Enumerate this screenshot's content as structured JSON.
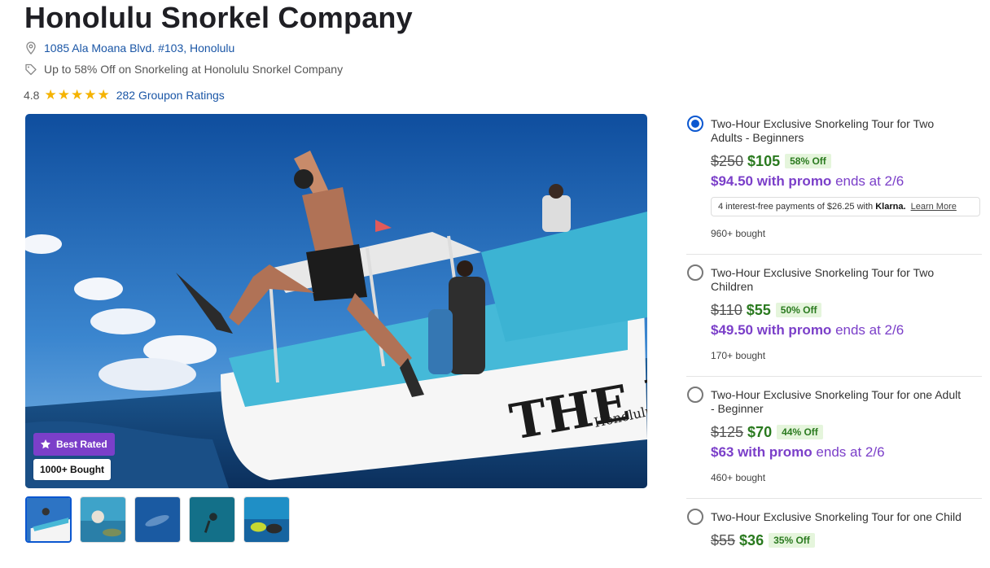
{
  "merchant": {
    "name": "Honolulu Snorkel Company",
    "address": "1085 Ala Moana Blvd. #103, Honolulu",
    "deal_summary": "Up to 58% Off on Snorkeling at Honolulu Snorkel Company",
    "rating": "4.8",
    "stars": 5,
    "ratings_count_label": "282 Groupon Ratings"
  },
  "gallery": {
    "badge_best": "Best Rated",
    "badge_bought": "1000+ Bought",
    "main_image_text": "THE LOLA",
    "main_image_subtext": "Honolulu",
    "thumbnails": 5
  },
  "options": [
    {
      "title": "Two-Hour Exclusive Snorkeling Tour for Two Adults - Beginners",
      "original_price": "$250",
      "price": "$105",
      "discount": "58% Off",
      "promo_price": "$94.50 with promo",
      "promo_ends": "ends at 2/6",
      "klarna": {
        "text": "4 interest-free payments of $26.25 with",
        "brand": "Klarna.",
        "link": "Learn More"
      },
      "bought": "960+ bought",
      "selected": true
    },
    {
      "title": "Two-Hour Exclusive Snorkeling Tour for Two Children",
      "original_price": "$110",
      "price": "$55",
      "discount": "50% Off",
      "promo_price": "$49.50 with promo",
      "promo_ends": "ends at 2/6",
      "bought": "170+ bought",
      "selected": false
    },
    {
      "title": "Two-Hour Exclusive Snorkeling Tour for one Adult - Beginner",
      "original_price": "$125",
      "price": "$70",
      "discount": "44% Off",
      "promo_price": "$63 with promo",
      "promo_ends": "ends at 2/6",
      "bought": "460+ bought",
      "selected": false
    },
    {
      "title": "Two-Hour Exclusive Snorkeling Tour for one Child",
      "original_price": "$55",
      "price": "$36",
      "discount": "35% Off",
      "selected": false
    }
  ],
  "colors": {
    "link": "#1a56a6",
    "price_green": "#2a7a1f",
    "promo_purple": "#7b3fc9",
    "radio_blue": "#0b57d0",
    "star": "#f5b301"
  }
}
